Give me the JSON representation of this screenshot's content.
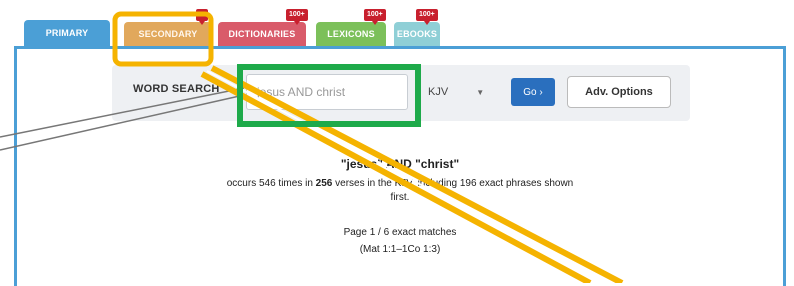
{
  "tabs": [
    {
      "label": "PRIMARY",
      "color": "#4b9fd6"
    },
    {
      "label": "SECONDARY",
      "color": "#e1a85c",
      "badge": ""
    },
    {
      "label": "DICTIONARIES",
      "color": "#d95b6a",
      "badge": "100+"
    },
    {
      "label": "LEXICONS",
      "color": "#7cc05a",
      "badge": "100+"
    },
    {
      "label": "EBOOKS",
      "color": "#8fcfd6",
      "badge": "100+"
    }
  ],
  "search": {
    "label": "WORD SEARCH",
    "value": "jesus AND christ",
    "version": "KJV",
    "go_label": "Go ›",
    "adv_label": "Adv. Options"
  },
  "results": {
    "query": "\"jesus\" AND \"christ\"",
    "summary_pre": "occurs 546 times in ",
    "summary_bold": "256",
    "summary_post": " verses in the KJV, including 196 exact phrases shown",
    "summary_line2": "first.",
    "page_info": "Page 1 / 6 exact matches",
    "range": "(Mat 1:1–1Co 1:3)"
  },
  "annotations": {
    "highlight_orange": "#f5b300",
    "highlight_green": "#1eaa4a",
    "callout_gray": "#777777"
  }
}
